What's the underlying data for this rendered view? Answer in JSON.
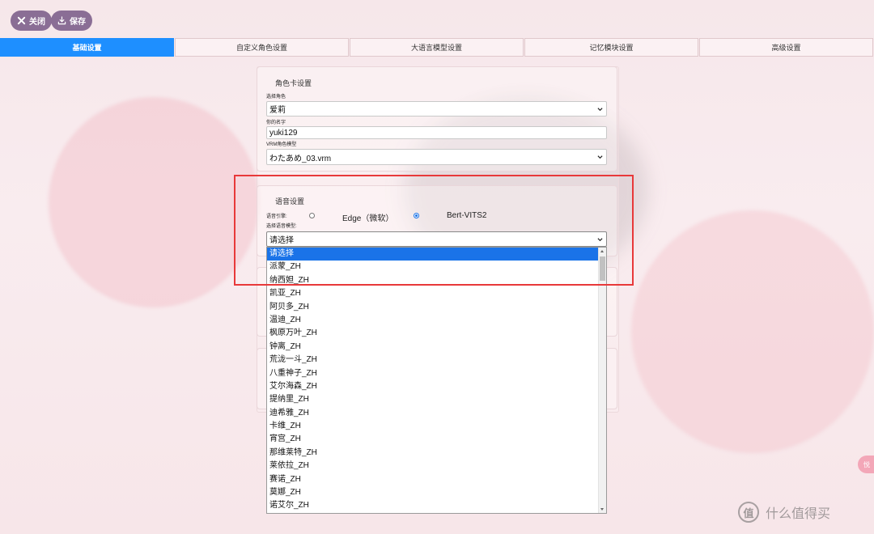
{
  "toolbar": {
    "close_label": "关闭",
    "save_label": "保存"
  },
  "tabs": [
    {
      "label": "基础设置",
      "active": true
    },
    {
      "label": "自定义角色设置",
      "active": false
    },
    {
      "label": "大语言模型设置",
      "active": false
    },
    {
      "label": "记忆模块设置",
      "active": false
    },
    {
      "label": "高级设置",
      "active": false
    }
  ],
  "character_card": {
    "title": "角色卡设置",
    "select_character_label": "选择角色",
    "select_character_value": "爱莉",
    "your_name_label": "你的名字",
    "your_name_value": "yuki129",
    "vrm_label": "VRM角色模型",
    "vrm_value": "わたあめ_03.vrm"
  },
  "voice": {
    "title": "语音设置",
    "engine_label": "语音引擎:",
    "engine_options": [
      {
        "label": "Edge（微软）",
        "checked": false
      },
      {
        "label": "Bert-VITS2",
        "checked": true
      }
    ],
    "model_label": "选择语音模型:",
    "model_value": "请选择",
    "model_options": [
      "请选择",
      "派蒙_ZH",
      "纳西妲_ZH",
      "凯亚_ZH",
      "阿贝多_ZH",
      "温迪_ZH",
      "枫原万叶_ZH",
      "钟离_ZH",
      "荒泷一斗_ZH",
      "八重神子_ZH",
      "艾尔海森_ZH",
      "提纳里_ZH",
      "迪希雅_ZH",
      "卡维_ZH",
      "宵宫_ZH",
      "那维莱特_ZH",
      "莱依拉_ZH",
      "赛诺_ZH",
      "莫娜_ZH",
      "诺艾尔_ZH"
    ],
    "selected_option_index": 0
  },
  "side_float": {
    "label": "悦"
  },
  "watermark": {
    "logo": "值",
    "text": "什么值得买"
  },
  "colors": {
    "accent": "#1e8fff",
    "top_button": "#8a6e95",
    "highlight": "#e8393a"
  }
}
